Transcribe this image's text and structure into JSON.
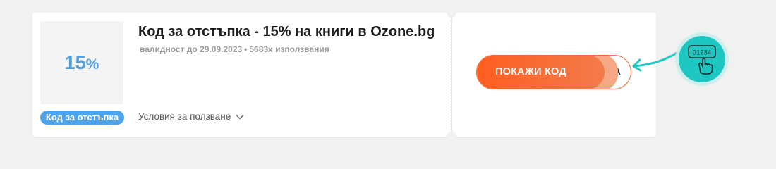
{
  "coupon": {
    "thumbnail_value": "15",
    "thumbnail_unit": "%",
    "badge_label": "Код за отстъпка",
    "title": "Код за отстъпка - 15% на книги в Ozone.bg",
    "validity": "валидност до 29.09.2023",
    "separator": "•",
    "usage": "5683x използвания",
    "terms_label": "Условия за ползване",
    "cta_label": "ПОКАЖИ КОД",
    "code_peek": "НА",
    "hint_code": "01234"
  },
  "colors": {
    "accent_blue": "#4da4ec",
    "cta_orange": "#ff5d1f",
    "hint_teal": "#1fc7c2"
  },
  "icons": {
    "terms_toggle": "chevron-down-icon",
    "hint_arrow": "curved-arrow-icon",
    "hint_hand": "hand-click-icon"
  }
}
